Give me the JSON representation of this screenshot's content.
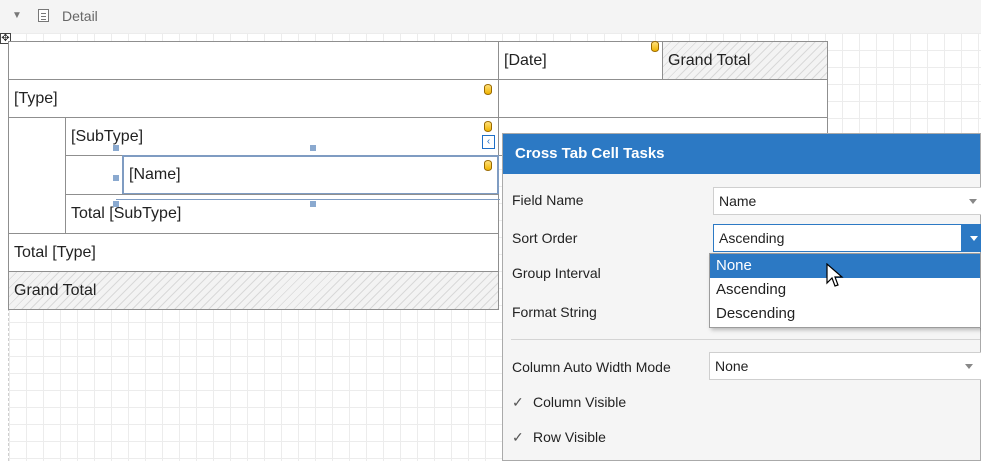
{
  "band": {
    "title": "Detail"
  },
  "crosstab": {
    "column_header": "[Date]",
    "grand_total_header": "Grand Total",
    "row_type": "[Type]",
    "row_subtype": "[SubType]",
    "row_name": "[Name]",
    "total_subtype": "Total [SubType]",
    "total_type": "Total [Type]",
    "grand_total_row": "Grand Total"
  },
  "panel": {
    "title": "Cross Tab Cell Tasks",
    "field_name_label": "Field Name",
    "field_name_value": "Name",
    "sort_order_label": "Sort Order",
    "sort_order_value": "Ascending",
    "group_interval_label": "Group Interval",
    "format_string_label": "Format String",
    "col_auto_width_label": "Column Auto Width Mode",
    "col_auto_width_value": "None",
    "column_visible_label": "Column Visible",
    "row_visible_label": "Row Visible",
    "column_visible_checked": true,
    "row_visible_checked": true
  },
  "dropdown": {
    "options": [
      "None",
      "Ascending",
      "Descending"
    ],
    "highlighted": "None"
  },
  "icons": {
    "collapse": "triangle-down-icon",
    "band": "band-icon",
    "data_field": "database-icon",
    "move": "move-icon",
    "smart_tag": "smart-tag-icon",
    "check": "check-icon",
    "cursor": "mouse-pointer-icon"
  },
  "colors": {
    "accent": "#2c79c4",
    "db_icon": "#f0b400"
  }
}
